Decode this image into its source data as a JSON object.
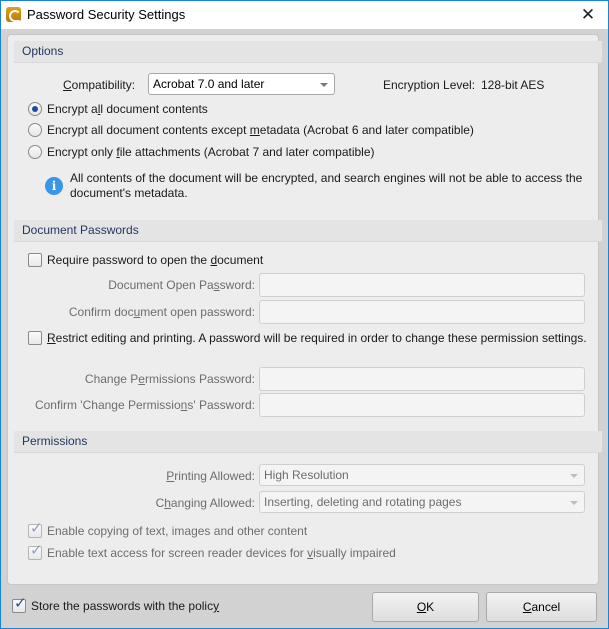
{
  "window": {
    "title": "Password Security Settings",
    "close_icon": "close-icon",
    "app_icon": "app-logo-icon"
  },
  "options": {
    "header": "Options",
    "compatibility_label": "Compatibility:",
    "compatibility_value": "Acrobat 7.0 and later",
    "encryption_level_label": "Encryption Level:",
    "encryption_level_value": "128-bit AES",
    "radios": [
      {
        "label": "Encrypt all document contents",
        "checked": true
      },
      {
        "label": "Encrypt all document contents except metadata (Acrobat 6 and later compatible)",
        "checked": false
      },
      {
        "label": "Encrypt only file attachments (Acrobat 7 and later compatible)",
        "checked": false
      }
    ],
    "info_icon": "info-icon",
    "info_line1": "All contents of the document will be encrypted, and search engines will not be able to access the",
    "info_line2": "document's metadata."
  },
  "document_passwords": {
    "header": "Document Passwords",
    "require_open_label": "Require password to open the document",
    "require_open_checked": false,
    "open_password_label": "Document Open Password:",
    "open_password_value": "",
    "confirm_open_label": "Confirm document open password:",
    "confirm_open_value": "",
    "restrict_label": "Restrict editing and printing. A password will be required in order to change these permission settings.",
    "restrict_checked": false,
    "change_perm_label": "Change Permissions Password:",
    "change_perm_value": "",
    "confirm_change_label": "Confirm 'Change Permissions' Password:",
    "confirm_change_value": ""
  },
  "permissions": {
    "header": "Permissions",
    "printing_label": "Printing Allowed:",
    "printing_value": "High Resolution",
    "changing_label": "Changing Allowed:",
    "changing_value": "Inserting, deleting and rotating pages",
    "copy_label": "Enable copying of text, images and other content",
    "copy_checked": true,
    "screen_reader_label": "Enable text access for screen reader devices for visually impaired",
    "screen_reader_checked": true
  },
  "footer": {
    "store_label": "Store the passwords with the policy",
    "store_checked": true,
    "ok_label": "OK",
    "cancel_label": "Cancel"
  }
}
